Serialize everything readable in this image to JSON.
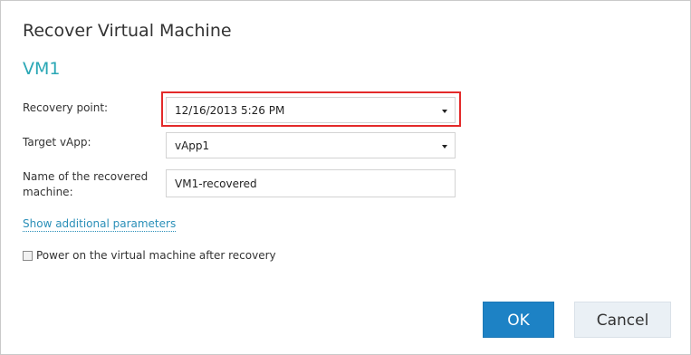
{
  "dialog": {
    "title": "Recover Virtual Machine",
    "vm_name": "VM1"
  },
  "form": {
    "recovery_point_label": "Recovery point:",
    "recovery_point_value": "12/16/2013 5:26 PM",
    "target_vapp_label": "Target vApp:",
    "target_vapp_value": "vApp1",
    "recovered_name_label_line1": "Name of the recovered",
    "recovered_name_label_line2": "machine:",
    "recovered_name_value": "VM1-recovered"
  },
  "links": {
    "additional_parameters": "Show additional parameters"
  },
  "options": {
    "power_on_label": "Power on the virtual machine after recovery",
    "power_on_checked": false
  },
  "buttons": {
    "ok_label": "OK",
    "cancel_label": "Cancel"
  },
  "colors": {
    "accent": "#2aa7b5",
    "primary_button": "#1d82c5",
    "highlight": "#e32a2a",
    "link": "#2a8fb8"
  },
  "icons": {
    "dropdown": "chevron-down-icon",
    "checkbox": "checkbox-icon"
  }
}
